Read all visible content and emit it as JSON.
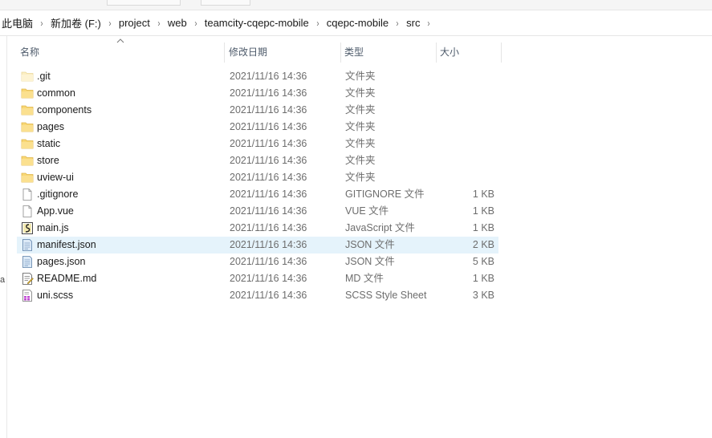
{
  "breadcrumb": {
    "items": [
      "此电脑",
      "新加卷 (F:)",
      "project",
      "web",
      "teamcity-cqepc-mobile",
      "cqepc-mobile",
      "src"
    ],
    "separator": "›"
  },
  "left_pane": {
    "visible_char": "a"
  },
  "columns": {
    "name": "名称",
    "date": "修改日期",
    "type": "类型",
    "size": "大小",
    "sorted_by": "name"
  },
  "files": [
    {
      "name": ".git",
      "date": "2021/11/16 14:36",
      "type": "文件夹",
      "size": "",
      "icon": "folder-icon-light"
    },
    {
      "name": "common",
      "date": "2021/11/16 14:36",
      "type": "文件夹",
      "size": "",
      "icon": "folder-icon"
    },
    {
      "name": "components",
      "date": "2021/11/16 14:36",
      "type": "文件夹",
      "size": "",
      "icon": "folder-icon"
    },
    {
      "name": "pages",
      "date": "2021/11/16 14:36",
      "type": "文件夹",
      "size": "",
      "icon": "folder-icon"
    },
    {
      "name": "static",
      "date": "2021/11/16 14:36",
      "type": "文件夹",
      "size": "",
      "icon": "folder-icon"
    },
    {
      "name": "store",
      "date": "2021/11/16 14:36",
      "type": "文件夹",
      "size": "",
      "icon": "folder-icon"
    },
    {
      "name": "uview-ui",
      "date": "2021/11/16 14:36",
      "type": "文件夹",
      "size": "",
      "icon": "folder-icon"
    },
    {
      "name": ".gitignore",
      "date": "2021/11/16 14:36",
      "type": "GITIGNORE 文件",
      "size": "1 KB",
      "icon": "blank-file-icon"
    },
    {
      "name": "App.vue",
      "date": "2021/11/16 14:36",
      "type": "VUE 文件",
      "size": "1 KB",
      "icon": "blank-file-icon"
    },
    {
      "name": "main.js",
      "date": "2021/11/16 14:36",
      "type": "JavaScript 文件",
      "size": "1 KB",
      "icon": "js-script-icon"
    },
    {
      "name": "manifest.json",
      "date": "2021/11/16 14:36",
      "type": "JSON 文件",
      "size": "2 KB",
      "icon": "json-file-icon",
      "selected": true
    },
    {
      "name": "pages.json",
      "date": "2021/11/16 14:36",
      "type": "JSON 文件",
      "size": "5 KB",
      "icon": "json-file-icon"
    },
    {
      "name": "README.md",
      "date": "2021/11/16 14:36",
      "type": "MD 文件",
      "size": "1 KB",
      "icon": "md-file-icon"
    },
    {
      "name": "uni.scss",
      "date": "2021/11/16 14:36",
      "type": "SCSS Style Sheet",
      "size": "3 KB",
      "icon": "scss-file-icon"
    }
  ],
  "colors": {
    "selected_row": "#e5f3fb",
    "folder": "#f8d775",
    "folder_dark": "#e0b548",
    "header_text": "#4d5a6a",
    "secondary_text": "#6d6d6d"
  }
}
